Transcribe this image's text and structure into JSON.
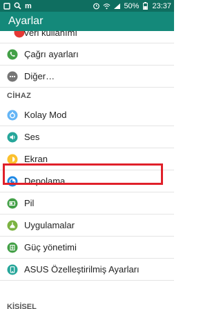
{
  "status_bar": {
    "carrier_mark": "m",
    "battery": "50%",
    "time": "23:37"
  },
  "app_bar": {
    "title": "Ayarlar"
  },
  "items_top": [
    {
      "label": "Veri kullanımı",
      "icon": "data-usage-icon",
      "color": "#e53935"
    },
    {
      "label": "Çağrı ayarları",
      "icon": "phone-icon",
      "color": "#43a047"
    },
    {
      "label": "Diğer…",
      "icon": "more-icon",
      "color": "#757575"
    }
  ],
  "sections": {
    "device": "CİHAZ",
    "personal": "KİŞİSEL"
  },
  "device_items": [
    {
      "label": "Kolay Mod",
      "icon": "easy-mode-icon",
      "color": "#64b5f6"
    },
    {
      "label": "Ses",
      "icon": "sound-icon",
      "color": "#26a69a"
    },
    {
      "label": "Ekran",
      "icon": "display-icon",
      "color": "#fbc02d"
    },
    {
      "label": "Depolama",
      "icon": "storage-icon",
      "color": "#1e88e5"
    },
    {
      "label": "Pil",
      "icon": "battery-icon",
      "color": "#43a047"
    },
    {
      "label": "Uygulamalar",
      "icon": "apps-icon",
      "color": "#7cb342"
    },
    {
      "label": "Güç yönetimi",
      "icon": "power-icon",
      "color": "#43a047"
    },
    {
      "label": "ASUS Özelleştirilmiş Ayarları",
      "icon": "asus-custom-icon",
      "color": "#26a69a"
    }
  ],
  "colors": {
    "status_bar": "#0f6e60",
    "app_bar": "#14897a",
    "highlight": "#e0202a"
  }
}
